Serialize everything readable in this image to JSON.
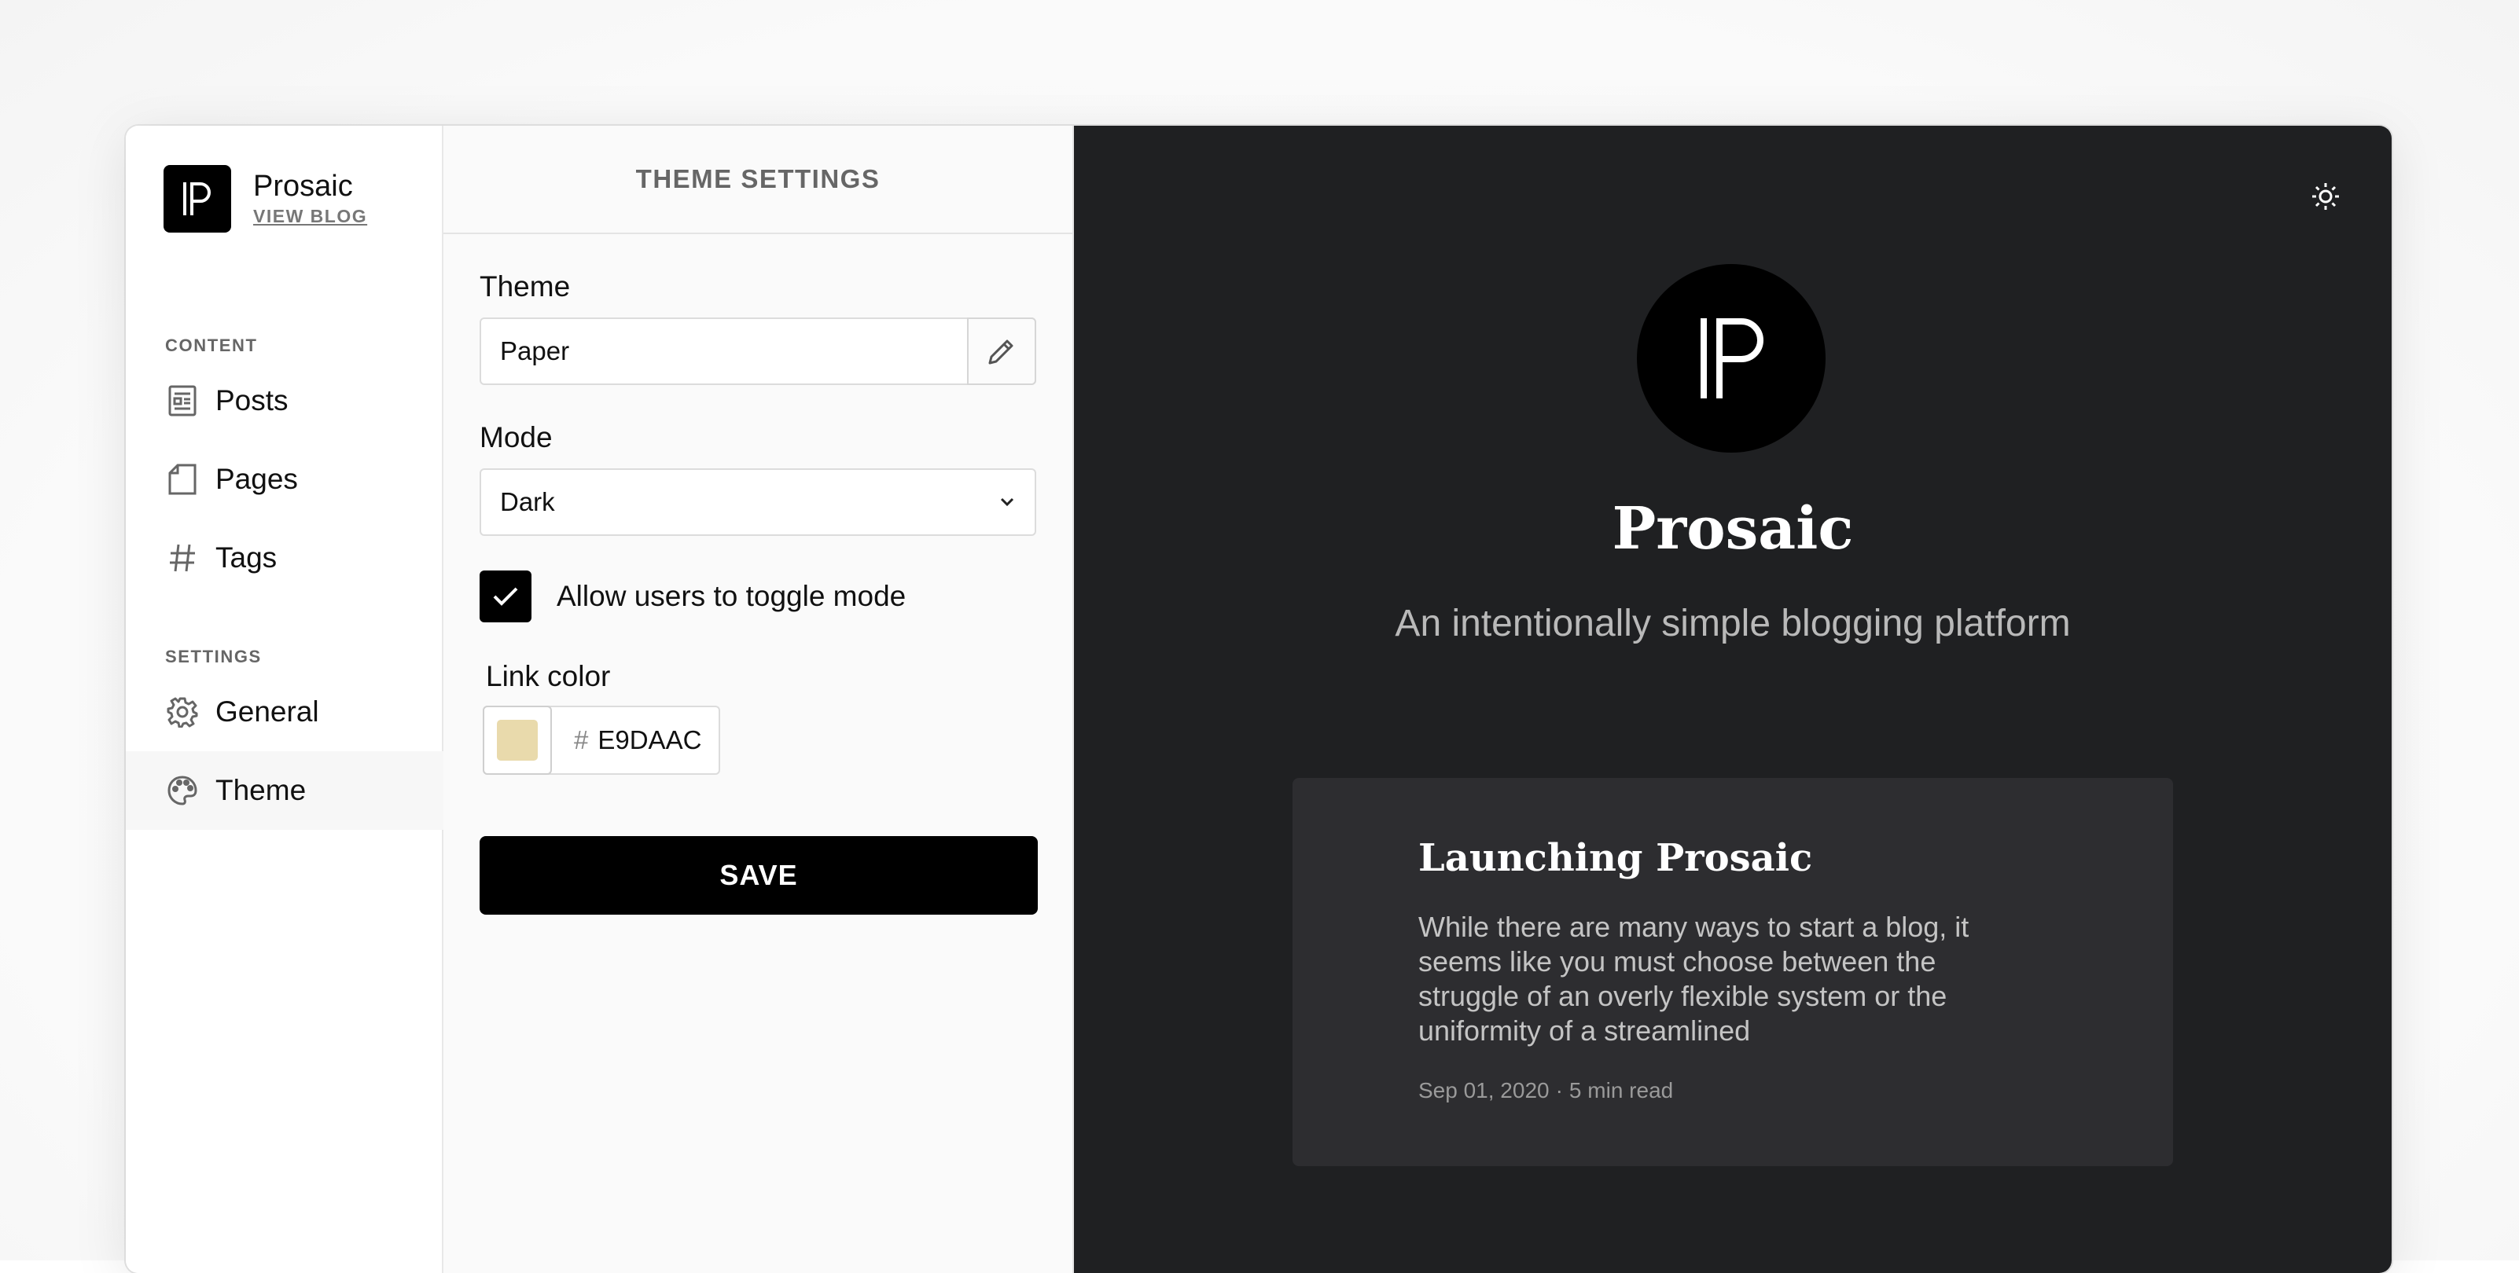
{
  "brand": {
    "name": "Prosaic",
    "view_blog_label": "VIEW BLOG",
    "logo_icon": "prosaic-logo-icon"
  },
  "sidebar": {
    "content_heading": "CONTENT",
    "content_items": [
      {
        "label": "Posts",
        "icon": "document-icon"
      },
      {
        "label": "Pages",
        "icon": "page-icon"
      },
      {
        "label": "Tags",
        "icon": "hash-icon"
      }
    ],
    "settings_heading": "SETTINGS",
    "settings_items": [
      {
        "label": "General",
        "icon": "gear-icon"
      },
      {
        "label": "Theme",
        "icon": "palette-icon",
        "active": true
      }
    ]
  },
  "settings": {
    "header": "THEME SETTINGS",
    "theme_label": "Theme",
    "theme_value": "Paper",
    "mode_label": "Mode",
    "mode_value": "Dark",
    "toggle_label": "Allow users to toggle mode",
    "toggle_checked": true,
    "link_color_label": "Link color",
    "link_color_hash": "#",
    "link_color_value": "E9DAAC",
    "link_color_hex": "#E9DAAC",
    "save_label": "SAVE"
  },
  "preview": {
    "title": "Prosaic",
    "subtitle": "An intentionally simple blogging platform",
    "post": {
      "title": "Launching Prosaic",
      "excerpt": "While there are many ways to start a blog, it seems like you must choose between the struggle of an overly flexible system or the uniformity of a streamlined",
      "date": "Sep 01, 2020",
      "separator": "·",
      "read_time": "5 min read"
    },
    "background": "#1F2022",
    "card_background": "#2D2D30"
  }
}
